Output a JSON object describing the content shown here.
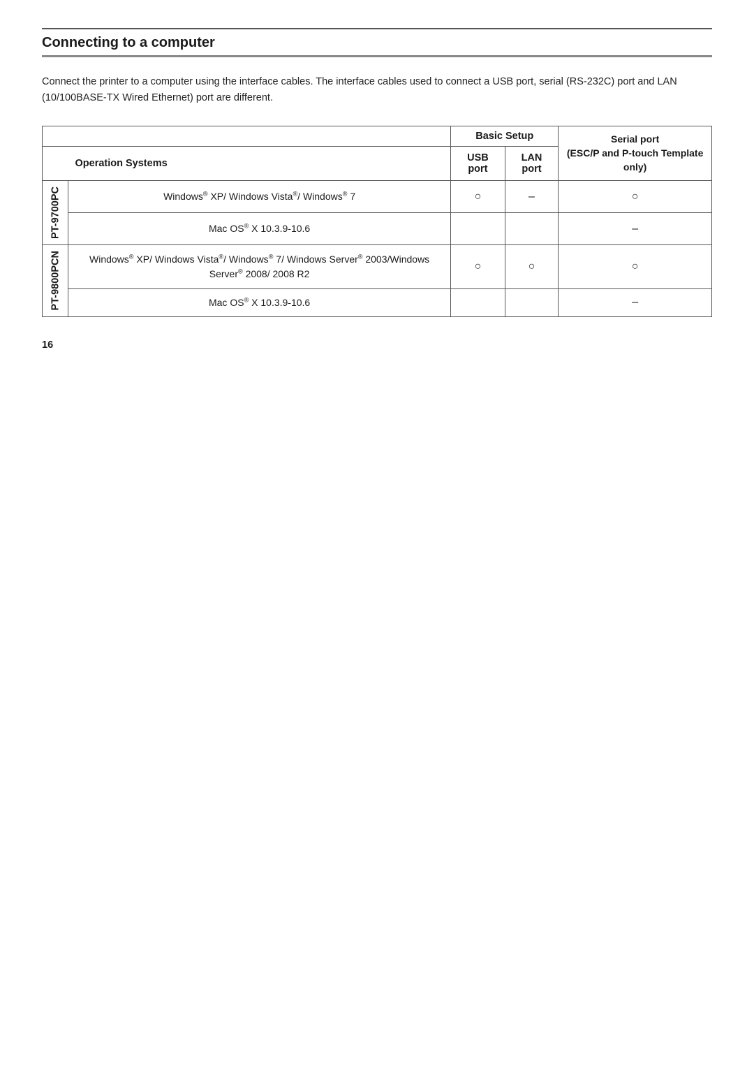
{
  "page": {
    "number": "16"
  },
  "section": {
    "title": "Connecting to a computer",
    "intro": "Connect the printer to a computer using the interface cables. The interface cables used to connect a USB port, serial (RS-232C) port and LAN (10/100BASE-TX Wired Ethernet) port are different."
  },
  "table": {
    "header": {
      "basic_setup": "Basic Setup",
      "serial_port": "Serial port",
      "serial_port_sub": "(ESC/P and P-touch Template only)",
      "op_systems": "Operation Systems",
      "usb_port": "USB port",
      "lan_port": "LAN port"
    },
    "devices": [
      {
        "id": "PT-9700PC",
        "label": "PT-9700PC",
        "rows": [
          {
            "os": "Windows® XP/ Windows Vista®/ Windows® 7",
            "usb": "O",
            "lan": "–",
            "serial": "O"
          },
          {
            "os": "Mac OS® X 10.3.9-10.6",
            "usb": "",
            "lan": "",
            "serial": "–"
          }
        ]
      },
      {
        "id": "PT-9800PCN",
        "label": "PT-9800PCN",
        "rows": [
          {
            "os": "Windows® XP/ Windows Vista®/ Windows® 7/ Windows Server® 2003/Windows Server® 2008/ 2008 R2",
            "usb": "O",
            "lan": "O",
            "serial": "O"
          },
          {
            "os": "Mac OS® X 10.3.9-10.6",
            "usb": "",
            "lan": "",
            "serial": "–"
          }
        ]
      }
    ]
  }
}
